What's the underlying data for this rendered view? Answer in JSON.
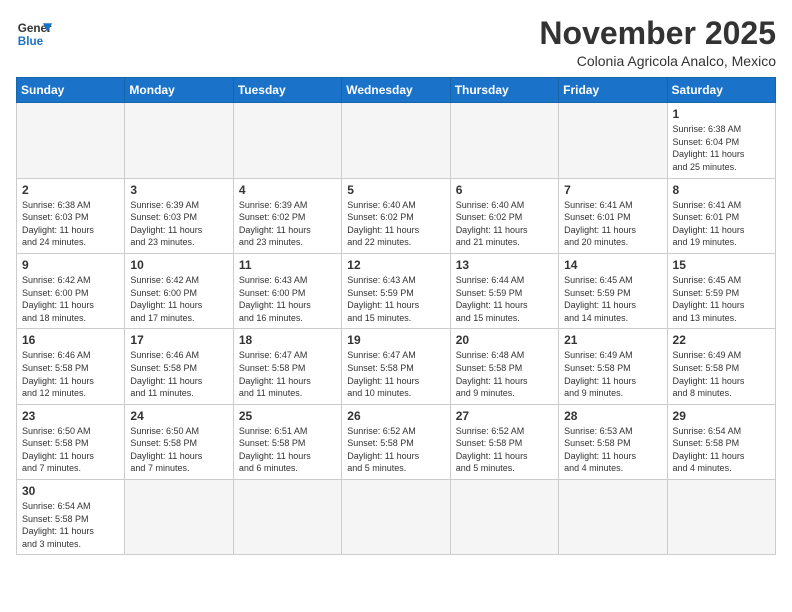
{
  "header": {
    "logo_general": "General",
    "logo_blue": "Blue",
    "month_title": "November 2025",
    "subtitle": "Colonia Agricola Analco, Mexico"
  },
  "days_of_week": [
    "Sunday",
    "Monday",
    "Tuesday",
    "Wednesday",
    "Thursday",
    "Friday",
    "Saturday"
  ],
  "weeks": [
    [
      {
        "day": "",
        "info": ""
      },
      {
        "day": "",
        "info": ""
      },
      {
        "day": "",
        "info": ""
      },
      {
        "day": "",
        "info": ""
      },
      {
        "day": "",
        "info": ""
      },
      {
        "day": "",
        "info": ""
      },
      {
        "day": "1",
        "info": "Sunrise: 6:38 AM\nSunset: 6:04 PM\nDaylight: 11 hours\nand 25 minutes."
      }
    ],
    [
      {
        "day": "2",
        "info": "Sunrise: 6:38 AM\nSunset: 6:03 PM\nDaylight: 11 hours\nand 24 minutes."
      },
      {
        "day": "3",
        "info": "Sunrise: 6:39 AM\nSunset: 6:03 PM\nDaylight: 11 hours\nand 23 minutes."
      },
      {
        "day": "4",
        "info": "Sunrise: 6:39 AM\nSunset: 6:02 PM\nDaylight: 11 hours\nand 23 minutes."
      },
      {
        "day": "5",
        "info": "Sunrise: 6:40 AM\nSunset: 6:02 PM\nDaylight: 11 hours\nand 22 minutes."
      },
      {
        "day": "6",
        "info": "Sunrise: 6:40 AM\nSunset: 6:02 PM\nDaylight: 11 hours\nand 21 minutes."
      },
      {
        "day": "7",
        "info": "Sunrise: 6:41 AM\nSunset: 6:01 PM\nDaylight: 11 hours\nand 20 minutes."
      },
      {
        "day": "8",
        "info": "Sunrise: 6:41 AM\nSunset: 6:01 PM\nDaylight: 11 hours\nand 19 minutes."
      }
    ],
    [
      {
        "day": "9",
        "info": "Sunrise: 6:42 AM\nSunset: 6:00 PM\nDaylight: 11 hours\nand 18 minutes."
      },
      {
        "day": "10",
        "info": "Sunrise: 6:42 AM\nSunset: 6:00 PM\nDaylight: 11 hours\nand 17 minutes."
      },
      {
        "day": "11",
        "info": "Sunrise: 6:43 AM\nSunset: 6:00 PM\nDaylight: 11 hours\nand 16 minutes."
      },
      {
        "day": "12",
        "info": "Sunrise: 6:43 AM\nSunset: 5:59 PM\nDaylight: 11 hours\nand 15 minutes."
      },
      {
        "day": "13",
        "info": "Sunrise: 6:44 AM\nSunset: 5:59 PM\nDaylight: 11 hours\nand 15 minutes."
      },
      {
        "day": "14",
        "info": "Sunrise: 6:45 AM\nSunset: 5:59 PM\nDaylight: 11 hours\nand 14 minutes."
      },
      {
        "day": "15",
        "info": "Sunrise: 6:45 AM\nSunset: 5:59 PM\nDaylight: 11 hours\nand 13 minutes."
      }
    ],
    [
      {
        "day": "16",
        "info": "Sunrise: 6:46 AM\nSunset: 5:58 PM\nDaylight: 11 hours\nand 12 minutes."
      },
      {
        "day": "17",
        "info": "Sunrise: 6:46 AM\nSunset: 5:58 PM\nDaylight: 11 hours\nand 11 minutes."
      },
      {
        "day": "18",
        "info": "Sunrise: 6:47 AM\nSunset: 5:58 PM\nDaylight: 11 hours\nand 11 minutes."
      },
      {
        "day": "19",
        "info": "Sunrise: 6:47 AM\nSunset: 5:58 PM\nDaylight: 11 hours\nand 10 minutes."
      },
      {
        "day": "20",
        "info": "Sunrise: 6:48 AM\nSunset: 5:58 PM\nDaylight: 11 hours\nand 9 minutes."
      },
      {
        "day": "21",
        "info": "Sunrise: 6:49 AM\nSunset: 5:58 PM\nDaylight: 11 hours\nand 9 minutes."
      },
      {
        "day": "22",
        "info": "Sunrise: 6:49 AM\nSunset: 5:58 PM\nDaylight: 11 hours\nand 8 minutes."
      }
    ],
    [
      {
        "day": "23",
        "info": "Sunrise: 6:50 AM\nSunset: 5:58 PM\nDaylight: 11 hours\nand 7 minutes."
      },
      {
        "day": "24",
        "info": "Sunrise: 6:50 AM\nSunset: 5:58 PM\nDaylight: 11 hours\nand 7 minutes."
      },
      {
        "day": "25",
        "info": "Sunrise: 6:51 AM\nSunset: 5:58 PM\nDaylight: 11 hours\nand 6 minutes."
      },
      {
        "day": "26",
        "info": "Sunrise: 6:52 AM\nSunset: 5:58 PM\nDaylight: 11 hours\nand 5 minutes."
      },
      {
        "day": "27",
        "info": "Sunrise: 6:52 AM\nSunset: 5:58 PM\nDaylight: 11 hours\nand 5 minutes."
      },
      {
        "day": "28",
        "info": "Sunrise: 6:53 AM\nSunset: 5:58 PM\nDaylight: 11 hours\nand 4 minutes."
      },
      {
        "day": "29",
        "info": "Sunrise: 6:54 AM\nSunset: 5:58 PM\nDaylight: 11 hours\nand 4 minutes."
      }
    ],
    [
      {
        "day": "30",
        "info": "Sunrise: 6:54 AM\nSunset: 5:58 PM\nDaylight: 11 hours\nand 3 minutes."
      },
      {
        "day": "",
        "info": ""
      },
      {
        "day": "",
        "info": ""
      },
      {
        "day": "",
        "info": ""
      },
      {
        "day": "",
        "info": ""
      },
      {
        "day": "",
        "info": ""
      },
      {
        "day": "",
        "info": ""
      }
    ]
  ]
}
